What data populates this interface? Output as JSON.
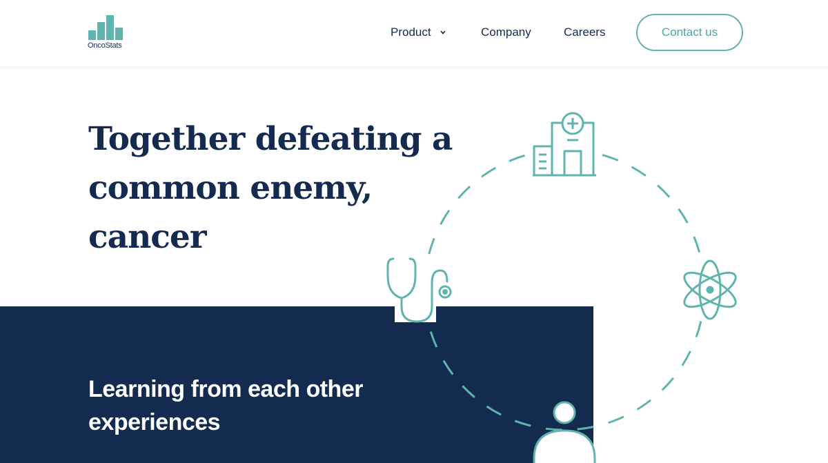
{
  "brand": {
    "name": "OncoStats",
    "accent_color": "#5fb5ad",
    "navy_color": "#132b4e"
  },
  "nav": {
    "product": "Product",
    "company": "Company",
    "careers": "Careers",
    "contact": "Contact us"
  },
  "hero": {
    "title": "Together defeating a common enemy, cancer"
  },
  "section": {
    "title": "Learning from each other experiences"
  },
  "illustration": {
    "icons": [
      "hospital-icon",
      "stethoscope-icon",
      "atom-icon",
      "person-icon"
    ]
  }
}
